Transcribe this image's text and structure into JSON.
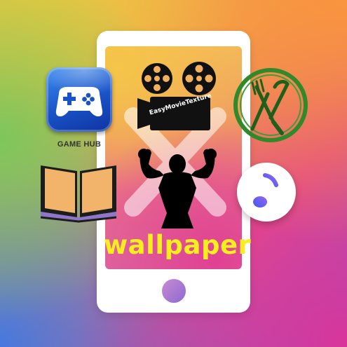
{
  "icons": {
    "game_hub": {
      "label": "GAME HUB",
      "icon": "gamepad-icon"
    },
    "movie": {
      "label": "EasyMovieTexture",
      "icon": "film-camera-icon"
    },
    "food": {
      "icon": "fork-knife-icon"
    },
    "book": {
      "icon": "open-book-icon"
    },
    "fitness": {
      "icon": "bodybuilder-icon"
    },
    "music": {
      "icon": "music-note-icon"
    }
  },
  "wallpaper_label": "wallpaper",
  "colors": {
    "phone": "#ffffff",
    "game_hub_blue": "#1952c6",
    "food_green": "#2f8a2a",
    "wallpaper_yellow": "#f7ee1d"
  }
}
